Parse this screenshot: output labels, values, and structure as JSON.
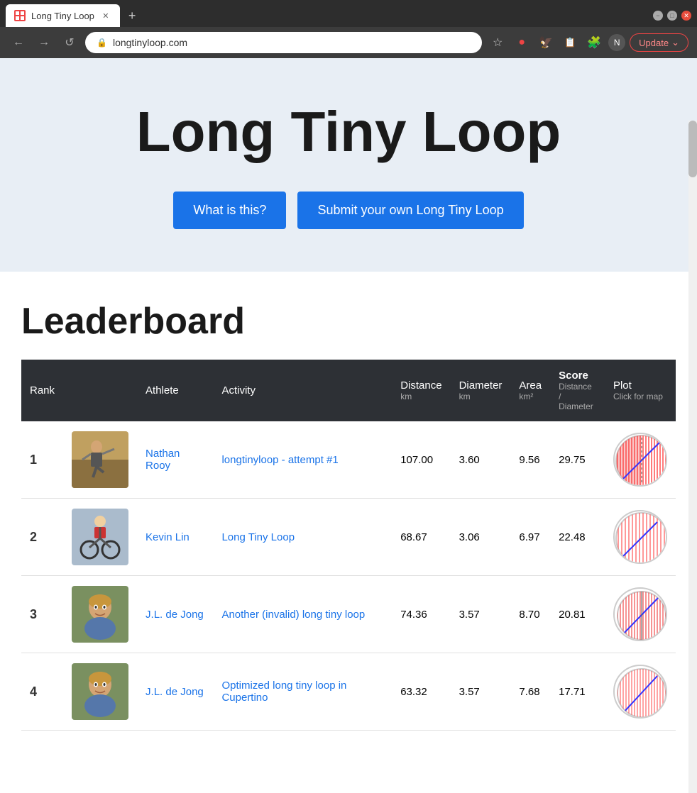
{
  "browser": {
    "tab_title": "Long Tiny Loop",
    "url": "longtinyloop.com",
    "new_tab_icon": "+",
    "nav": {
      "back": "←",
      "forward": "→",
      "reload": "↺"
    },
    "window_controls": {
      "minimize": "−",
      "maximize": "□",
      "close": "✕"
    },
    "update_label": "Update"
  },
  "hero": {
    "title": "Long Tiny Loop",
    "btn_what": "What is this?",
    "btn_submit": "Submit your own Long Tiny Loop"
  },
  "leaderboard": {
    "title": "Leaderboard",
    "columns": {
      "rank": "Rank",
      "athlete": "Athlete",
      "activity": "Activity",
      "distance": "Distance",
      "distance_unit": "km",
      "diameter": "Diameter",
      "diameter_unit": "km",
      "area": "Area",
      "area_unit": "km²",
      "score": "Score",
      "score_sub": "Distance /",
      "score_sub2": "Diameter",
      "plot": "Plot",
      "plot_sub": "Click for map"
    },
    "rows": [
      {
        "rank": "1",
        "athlete": "Nathan Rooy",
        "activity": "longtinyloop - attempt #1",
        "distance": "107.00",
        "diameter": "3.60",
        "area": "9.56",
        "score": "29.75",
        "photo_bg": "#c8a060",
        "plot_color": "#f44"
      },
      {
        "rank": "2",
        "athlete": "Kevin Lin",
        "activity": "Long Tiny Loop",
        "distance": "68.67",
        "diameter": "3.06",
        "area": "6.97",
        "score": "22.48",
        "photo_bg": "#8899aa",
        "plot_color": "#f44"
      },
      {
        "rank": "3",
        "athlete": "J.L. de Jong",
        "activity": "Another (invalid) long tiny loop",
        "distance": "74.36",
        "diameter": "3.57",
        "area": "8.70",
        "score": "20.81",
        "photo_bg": "#bbaa88",
        "plot_color": "#f44"
      },
      {
        "rank": "4",
        "athlete": "J.L. de Jong",
        "activity": "Optimized long tiny loop in Cupertino",
        "distance": "63.32",
        "diameter": "3.57",
        "area": "7.68",
        "score": "17.71",
        "photo_bg": "#bbaa88",
        "plot_color": "#f44"
      }
    ]
  }
}
